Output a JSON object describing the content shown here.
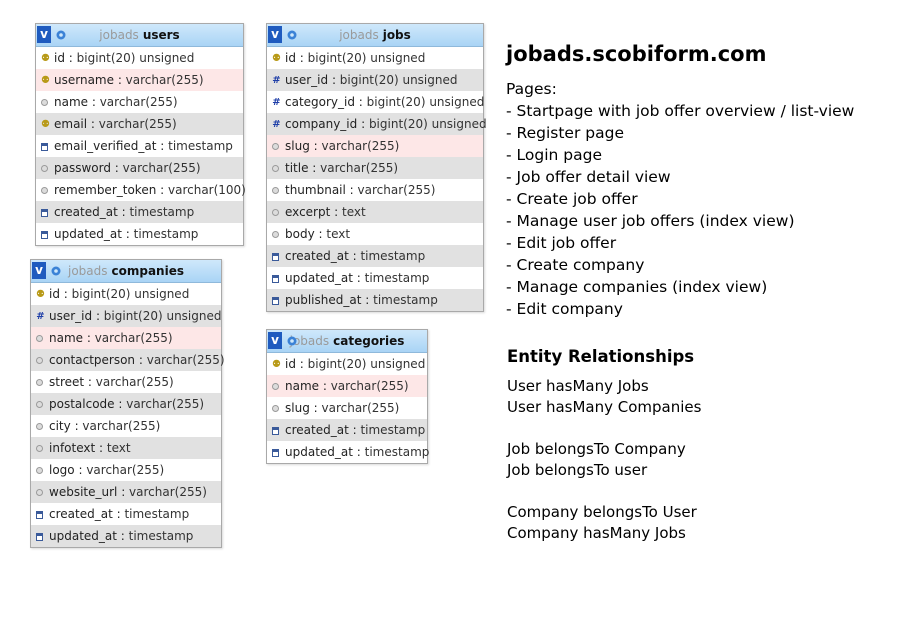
{
  "tables": [
    {
      "id": "users",
      "db": "jobads",
      "name": "users",
      "columns": [
        {
          "icon": "key",
          "name": "id",
          "type": "bigint(20) unsigned"
        },
        {
          "icon": "key",
          "name": "username",
          "type": "varchar(255)"
        },
        {
          "icon": "dot",
          "name": "name",
          "type": "varchar(255)"
        },
        {
          "icon": "key",
          "name": "email",
          "type": "varchar(255)"
        },
        {
          "icon": "cal",
          "name": "email_verified_at",
          "type": "timestamp"
        },
        {
          "icon": "dot",
          "name": "password",
          "type": "varchar(255)"
        },
        {
          "icon": "dot",
          "name": "remember_token",
          "type": "varchar(100)"
        },
        {
          "icon": "cal",
          "name": "created_at",
          "type": "timestamp"
        },
        {
          "icon": "cal",
          "name": "updated_at",
          "type": "timestamp"
        }
      ]
    },
    {
      "id": "jobs",
      "db": "jobads",
      "name": "jobs",
      "columns": [
        {
          "icon": "key",
          "name": "id",
          "type": "bigint(20) unsigned"
        },
        {
          "icon": "hash",
          "name": "user_id",
          "type": "bigint(20) unsigned"
        },
        {
          "icon": "hash",
          "name": "category_id",
          "type": "bigint(20) unsigned"
        },
        {
          "icon": "hash",
          "name": "company_id",
          "type": "bigint(20) unsigned"
        },
        {
          "icon": "dot",
          "name": "slug",
          "type": "varchar(255)"
        },
        {
          "icon": "dot",
          "name": "title",
          "type": "varchar(255)"
        },
        {
          "icon": "dot",
          "name": "thumbnail",
          "type": "varchar(255)"
        },
        {
          "icon": "dot",
          "name": "excerpt",
          "type": "text"
        },
        {
          "icon": "dot",
          "name": "body",
          "type": "text"
        },
        {
          "icon": "cal",
          "name": "created_at",
          "type": "timestamp"
        },
        {
          "icon": "cal",
          "name": "updated_at",
          "type": "timestamp"
        },
        {
          "icon": "cal",
          "name": "published_at",
          "type": "timestamp"
        }
      ]
    },
    {
      "id": "companies",
      "db": "jobads",
      "name": "companies",
      "columns": [
        {
          "icon": "key",
          "name": "id",
          "type": "bigint(20) unsigned"
        },
        {
          "icon": "hash",
          "name": "user_id",
          "type": "bigint(20) unsigned"
        },
        {
          "icon": "dot",
          "name": "name",
          "type": "varchar(255)"
        },
        {
          "icon": "dot",
          "name": "contactperson",
          "type": "varchar(255)"
        },
        {
          "icon": "dot",
          "name": "street",
          "type": "varchar(255)"
        },
        {
          "icon": "dot",
          "name": "postalcode",
          "type": "varchar(255)"
        },
        {
          "icon": "dot",
          "name": "city",
          "type": "varchar(255)"
        },
        {
          "icon": "dot",
          "name": "infotext",
          "type": "text"
        },
        {
          "icon": "dot",
          "name": "logo",
          "type": "varchar(255)"
        },
        {
          "icon": "dot",
          "name": "website_url",
          "type": "varchar(255)"
        },
        {
          "icon": "cal",
          "name": "created_at",
          "type": "timestamp"
        },
        {
          "icon": "cal",
          "name": "updated_at",
          "type": "timestamp"
        }
      ]
    },
    {
      "id": "categories",
      "db": "jobads",
      "name": "categories",
      "columns": [
        {
          "icon": "key",
          "name": "id",
          "type": "bigint(20) unsigned"
        },
        {
          "icon": "dot",
          "name": "name",
          "type": "varchar(255)"
        },
        {
          "icon": "dot",
          "name": "slug",
          "type": "varchar(255)"
        },
        {
          "icon": "cal",
          "name": "created_at",
          "type": "timestamp"
        },
        {
          "icon": "cal",
          "name": "updated_at",
          "type": "timestamp"
        }
      ]
    }
  ],
  "site_title": "jobads.scobiform.com",
  "pages_heading": "Pages:",
  "pages": [
    "- Startpage with job offer overview / list-view",
    "- Register page",
    "- Login page",
    "- Job offer detail view",
    "- Create job offer",
    "- Manage user job offers (index view)",
    "- Edit job offer",
    "- Create company",
    "- Manage companies (index view)",
    "- Edit company"
  ],
  "relationships_heading": "Entity Relationships",
  "relationships": [
    "User hasMany Jobs",
    "User hasMany Companies",
    "",
    "Job belongsTo Company",
    "Job belongsTo user",
    "",
    "Company belongsTo User",
    "Company hasMany Jobs"
  ]
}
